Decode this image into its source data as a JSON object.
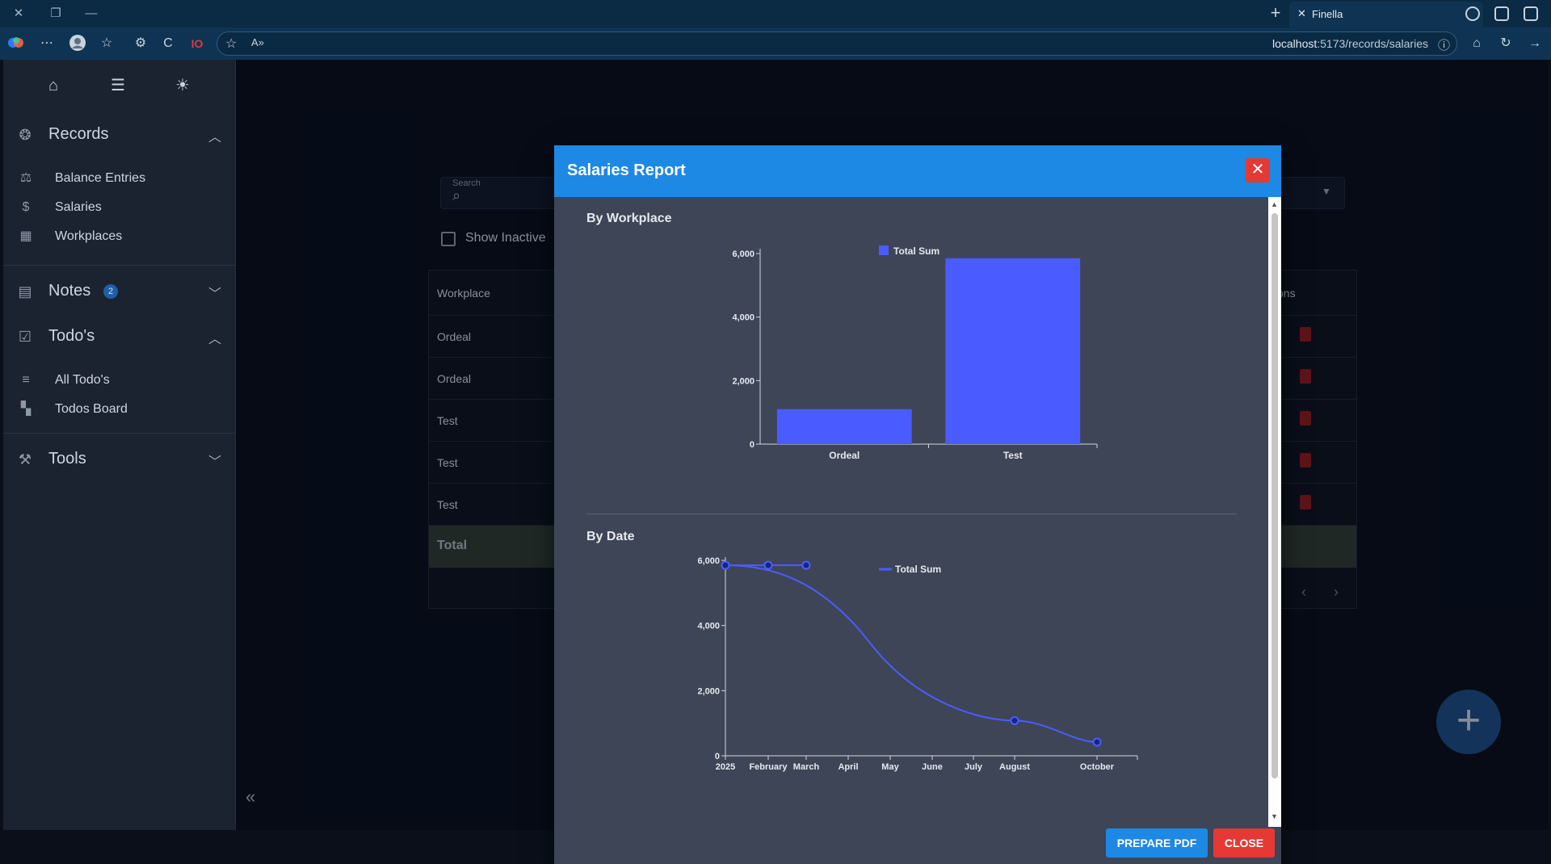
{
  "browser": {
    "tab_title": "Finella",
    "url_host": "localhost",
    "url_path": ":5173/records/salaries"
  },
  "sidebar": {
    "sections": [
      {
        "label": "Records",
        "items": [
          "Balance Entries",
          "Salaries",
          "Workplaces"
        ]
      },
      {
        "label": "Notes",
        "badge": "2"
      },
      {
        "label": "Todo's",
        "items": [
          "All Todo's",
          "Todos Board"
        ]
      },
      {
        "label": "Tools"
      }
    ]
  },
  "page": {
    "search_label": "Search",
    "show_inactive_label": "Show Inactive",
    "table_header_workplace": "Workplace",
    "table_header_actions": "ons",
    "rows": [
      "Ordeal",
      "Ordeal",
      "Test",
      "Test",
      "Test"
    ],
    "total_label": "Total"
  },
  "modal": {
    "title": "Salaries Report",
    "section1_title": "By Workplace",
    "section2_title": "By Date",
    "prepare_pdf_label": "PREPARE PDF",
    "close_label": "CLOSE"
  },
  "chart_data": [
    {
      "type": "bar",
      "title": "By Workplace",
      "categories": [
        "Ordeal",
        "Test"
      ],
      "series": [
        {
          "name": "Total Sum",
          "values": [
            1100,
            5850
          ]
        }
      ],
      "ylim": [
        0,
        6000
      ],
      "yticks": [
        "0",
        "2,000",
        "4,000",
        "6,000"
      ],
      "legend": "top",
      "color": "#4a5cff"
    },
    {
      "type": "line",
      "title": "By Date",
      "x_ticks": [
        "2025",
        "February",
        "March",
        "April",
        "May",
        "June",
        "July",
        "August",
        "October"
      ],
      "x": [
        "2025",
        "February",
        "March",
        "August",
        "October"
      ],
      "series": [
        {
          "name": "Total Sum",
          "values": [
            5850,
            5850,
            5850,
            1080,
            420
          ]
        }
      ],
      "ylim": [
        0,
        6000
      ],
      "yticks": [
        "0",
        "2,000",
        "4,000",
        "6,000"
      ],
      "legend": "top",
      "color": "#4a5cff"
    }
  ]
}
